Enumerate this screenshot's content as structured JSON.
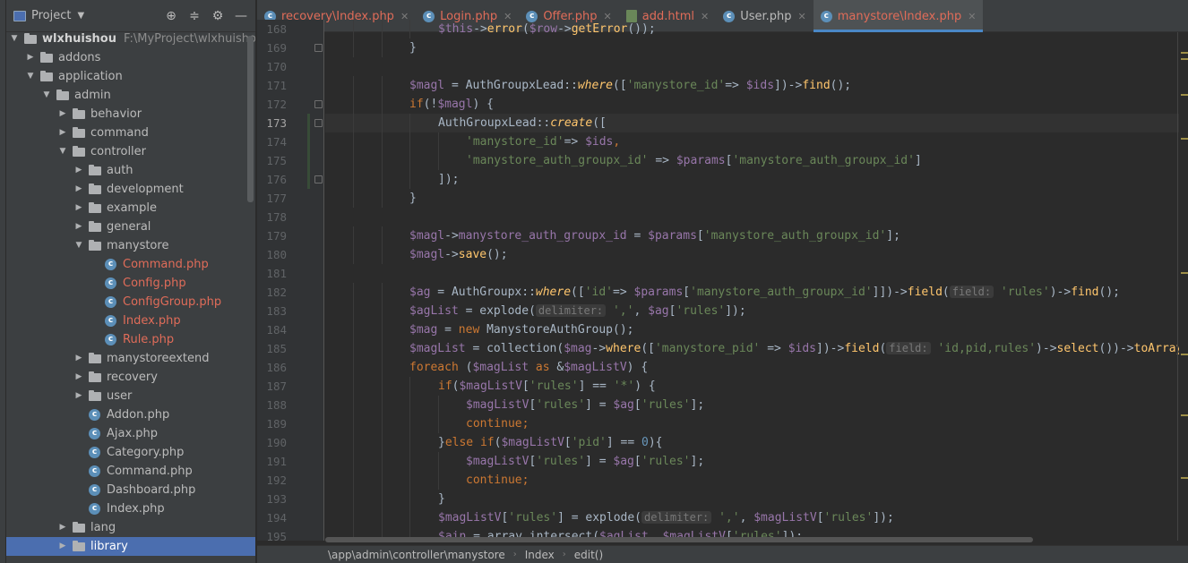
{
  "project_panel": {
    "title": "Project",
    "tools": [
      "crosshair-icon",
      "collapse-icon",
      "gear-icon",
      "minimize-icon"
    ],
    "tree": [
      {
        "level": 0,
        "type": "folder",
        "open": true,
        "label": "wlxhuishou",
        "path": "F:\\MyProject\\wlxhuishou",
        "bold": true
      },
      {
        "level": 1,
        "type": "folder",
        "open": false,
        "label": "addons"
      },
      {
        "level": 1,
        "type": "folder",
        "open": true,
        "label": "application"
      },
      {
        "level": 2,
        "type": "folder",
        "open": true,
        "label": "admin"
      },
      {
        "level": 3,
        "type": "folder",
        "open": false,
        "label": "behavior"
      },
      {
        "level": 3,
        "type": "folder",
        "open": false,
        "label": "command"
      },
      {
        "level": 3,
        "type": "folder",
        "open": true,
        "label": "controller"
      },
      {
        "level": 4,
        "type": "folder",
        "open": false,
        "label": "auth"
      },
      {
        "level": 4,
        "type": "folder",
        "open": false,
        "label": "development"
      },
      {
        "level": 4,
        "type": "folder",
        "open": false,
        "label": "example"
      },
      {
        "level": 4,
        "type": "folder",
        "open": false,
        "label": "general"
      },
      {
        "level": 4,
        "type": "folder",
        "open": true,
        "label": "manystore"
      },
      {
        "level": 5,
        "type": "php",
        "label": "Command.php",
        "modified": true
      },
      {
        "level": 5,
        "type": "php",
        "label": "Config.php",
        "modified": true
      },
      {
        "level": 5,
        "type": "php",
        "label": "ConfigGroup.php",
        "modified": true
      },
      {
        "level": 5,
        "type": "php",
        "label": "Index.php",
        "modified": true
      },
      {
        "level": 5,
        "type": "php",
        "label": "Rule.php",
        "modified": true
      },
      {
        "level": 4,
        "type": "folder",
        "open": false,
        "label": "manystoreextend"
      },
      {
        "level": 4,
        "type": "folder",
        "open": false,
        "label": "recovery"
      },
      {
        "level": 4,
        "type": "folder",
        "open": false,
        "label": "user"
      },
      {
        "level": 4,
        "type": "php",
        "label": "Addon.php"
      },
      {
        "level": 4,
        "type": "php",
        "label": "Ajax.php"
      },
      {
        "level": 4,
        "type": "php",
        "label": "Category.php"
      },
      {
        "level": 4,
        "type": "php",
        "label": "Command.php"
      },
      {
        "level": 4,
        "type": "php",
        "label": "Dashboard.php"
      },
      {
        "level": 4,
        "type": "php",
        "label": "Index.php"
      },
      {
        "level": 3,
        "type": "folder",
        "open": false,
        "label": "lang"
      },
      {
        "level": 3,
        "type": "folder",
        "open": false,
        "label": "library",
        "selected": true
      }
    ]
  },
  "tabs": [
    {
      "label": "recovery\\Index.php",
      "icon": "php-icon",
      "modified": true,
      "active": false
    },
    {
      "label": "Login.php",
      "icon": "php-icon",
      "modified": true,
      "active": false
    },
    {
      "label": "Offer.php",
      "icon": "php-icon",
      "modified": true,
      "active": false
    },
    {
      "label": "add.html",
      "icon": "html-icon",
      "modified": true,
      "active": false
    },
    {
      "label": "User.php",
      "icon": "php-icon",
      "modified": false,
      "active": false
    },
    {
      "label": "manystore\\Index.php",
      "icon": "php-icon",
      "modified": true,
      "active": true
    }
  ],
  "editor": {
    "current_line": 173,
    "lines": [
      {
        "n": 168,
        "indent": 16,
        "tokens": [
          [
            "var",
            "$this"
          ],
          [
            "",
            "->"
          ],
          [
            "fn",
            "error"
          ],
          [
            "",
            "("
          ],
          [
            "var",
            "$row"
          ],
          [
            "",
            "->"
          ],
          [
            "fn",
            "getError"
          ],
          [
            "",
            "());"
          ]
        ]
      },
      {
        "n": 169,
        "indent": 12,
        "tokens": [
          [
            "",
            "}"
          ]
        ]
      },
      {
        "n": 170,
        "indent": 0,
        "tokens": []
      },
      {
        "n": 171,
        "indent": 12,
        "tokens": [
          [
            "var",
            "$magl"
          ],
          [
            "",
            " = "
          ],
          [
            "cls",
            "AuthGroupxLead"
          ],
          [
            "",
            "::"
          ],
          [
            "static",
            "where"
          ],
          [
            "",
            "(["
          ],
          [
            "str",
            "'manystore_id'"
          ],
          [
            "",
            "=> "
          ],
          [
            "var",
            "$ids"
          ],
          [
            "",
            "])->"
          ],
          [
            "fn",
            "find"
          ],
          [
            "",
            "();"
          ]
        ]
      },
      {
        "n": 172,
        "indent": 12,
        "tokens": [
          [
            "kw",
            "if"
          ],
          [
            "",
            "(!"
          ],
          [
            "var",
            "$magl"
          ],
          [
            "",
            ") {"
          ]
        ]
      },
      {
        "n": 173,
        "indent": 16,
        "tokens": [
          [
            "cls",
            "AuthGroupxLead"
          ],
          [
            "",
            "::"
          ],
          [
            "static",
            "create"
          ],
          [
            "",
            "(["
          ]
        ]
      },
      {
        "n": 174,
        "indent": 20,
        "tokens": [
          [
            "str",
            "'manystore_id'"
          ],
          [
            "",
            "=> "
          ],
          [
            "var",
            "$ids"
          ],
          [
            "kw",
            ","
          ]
        ]
      },
      {
        "n": 175,
        "indent": 20,
        "tokens": [
          [
            "str",
            "'manystore_auth_groupx_id'"
          ],
          [
            "",
            " => "
          ],
          [
            "var",
            "$params"
          ],
          [
            "",
            "["
          ],
          [
            "str",
            "'manystore_auth_groupx_id'"
          ],
          [
            "",
            "]"
          ]
        ]
      },
      {
        "n": 176,
        "indent": 16,
        "tokens": [
          [
            "",
            "]);"
          ]
        ]
      },
      {
        "n": 177,
        "indent": 12,
        "tokens": [
          [
            "",
            "}"
          ]
        ]
      },
      {
        "n": 178,
        "indent": 0,
        "tokens": []
      },
      {
        "n": 179,
        "indent": 12,
        "tokens": [
          [
            "var",
            "$magl"
          ],
          [
            "",
            "->"
          ],
          [
            "var",
            "manystore_auth_groupx_id"
          ],
          [
            "",
            " = "
          ],
          [
            "var",
            "$params"
          ],
          [
            "",
            "["
          ],
          [
            "str",
            "'manystore_auth_groupx_id'"
          ],
          [
            "",
            "];"
          ]
        ]
      },
      {
        "n": 180,
        "indent": 12,
        "tokens": [
          [
            "var",
            "$magl"
          ],
          [
            "",
            "->"
          ],
          [
            "fn",
            "save"
          ],
          [
            "",
            "();"
          ]
        ]
      },
      {
        "n": 181,
        "indent": 0,
        "tokens": []
      },
      {
        "n": 182,
        "indent": 12,
        "tokens": [
          [
            "var",
            "$ag"
          ],
          [
            "",
            " = "
          ],
          [
            "cls",
            "AuthGroupx"
          ],
          [
            "",
            "::"
          ],
          [
            "static",
            "where"
          ],
          [
            "",
            "(["
          ],
          [
            "str",
            "'id'"
          ],
          [
            "",
            "=> "
          ],
          [
            "var",
            "$params"
          ],
          [
            "",
            "["
          ],
          [
            "str",
            "'manystore_auth_groupx_id'"
          ],
          [
            "",
            "]])->"
          ],
          [
            "fn",
            "field"
          ],
          [
            "",
            "("
          ],
          [
            "hint",
            "field:"
          ],
          [
            "str",
            " 'rules'"
          ],
          [
            "",
            ")->"
          ],
          [
            "fn",
            "find"
          ],
          [
            "",
            "();"
          ]
        ]
      },
      {
        "n": 183,
        "indent": 12,
        "tokens": [
          [
            "var",
            "$agList"
          ],
          [
            "",
            " = "
          ],
          [
            "",
            "explode("
          ],
          [
            "hint",
            "delimiter:"
          ],
          [
            "str",
            " ','"
          ],
          [
            "",
            ", "
          ],
          [
            "var",
            "$ag"
          ],
          [
            "",
            "["
          ],
          [
            "str",
            "'rules'"
          ],
          [
            "",
            "]);"
          ]
        ]
      },
      {
        "n": 184,
        "indent": 12,
        "tokens": [
          [
            "var",
            "$mag"
          ],
          [
            "",
            " = "
          ],
          [
            "kw",
            "new "
          ],
          [
            "cls",
            "ManystoreAuthGroup"
          ],
          [
            "",
            "();"
          ]
        ]
      },
      {
        "n": 185,
        "indent": 12,
        "tokens": [
          [
            "var",
            "$magList"
          ],
          [
            "",
            " = "
          ],
          [
            "",
            "collection("
          ],
          [
            "var",
            "$mag"
          ],
          [
            "",
            "->"
          ],
          [
            "fn",
            "where"
          ],
          [
            "",
            "(["
          ],
          [
            "str",
            "'manystore_pid'"
          ],
          [
            "",
            " => "
          ],
          [
            "var",
            "$ids"
          ],
          [
            "",
            "])->"
          ],
          [
            "fn",
            "field"
          ],
          [
            "",
            "("
          ],
          [
            "hint",
            "field:"
          ],
          [
            "str",
            " 'id,pid,rules'"
          ],
          [
            "",
            ")->"
          ],
          [
            "fn",
            "select"
          ],
          [
            "",
            "())->"
          ],
          [
            "fn",
            "toArray"
          ],
          [
            "",
            "());"
          ]
        ]
      },
      {
        "n": 186,
        "indent": 12,
        "tokens": [
          [
            "kw",
            "foreach "
          ],
          [
            "",
            "("
          ],
          [
            "var",
            "$magList"
          ],
          [
            "kw",
            " as "
          ],
          [
            "",
            "&"
          ],
          [
            "var",
            "$magListV"
          ],
          [
            "",
            ") {"
          ]
        ]
      },
      {
        "n": 187,
        "indent": 16,
        "tokens": [
          [
            "kw",
            "if"
          ],
          [
            "",
            "("
          ],
          [
            "var",
            "$magListV"
          ],
          [
            "",
            "["
          ],
          [
            "str",
            "'rules'"
          ],
          [
            "",
            "] == "
          ],
          [
            "str",
            "'*'"
          ],
          [
            "",
            ") {"
          ]
        ]
      },
      {
        "n": 188,
        "indent": 20,
        "tokens": [
          [
            "var",
            "$magListV"
          ],
          [
            "",
            "["
          ],
          [
            "str",
            "'rules'"
          ],
          [
            "",
            "] = "
          ],
          [
            "var",
            "$ag"
          ],
          [
            "",
            "["
          ],
          [
            "str",
            "'rules'"
          ],
          [
            "",
            "];"
          ]
        ]
      },
      {
        "n": 189,
        "indent": 20,
        "tokens": [
          [
            "kw",
            "continue;"
          ]
        ]
      },
      {
        "n": 190,
        "indent": 16,
        "tokens": [
          [
            "",
            "}"
          ],
          [
            "kw",
            "else if"
          ],
          [
            "",
            "("
          ],
          [
            "var",
            "$magListV"
          ],
          [
            "",
            "["
          ],
          [
            "str",
            "'pid'"
          ],
          [
            "",
            "] == "
          ],
          [
            "num",
            "0"
          ],
          [
            "",
            "){"
          ]
        ]
      },
      {
        "n": 191,
        "indent": 20,
        "tokens": [
          [
            "var",
            "$magListV"
          ],
          [
            "",
            "["
          ],
          [
            "str",
            "'rules'"
          ],
          [
            "",
            "] = "
          ],
          [
            "var",
            "$ag"
          ],
          [
            "",
            "["
          ],
          [
            "str",
            "'rules'"
          ],
          [
            "",
            "];"
          ]
        ]
      },
      {
        "n": 192,
        "indent": 20,
        "tokens": [
          [
            "kw",
            "continue;"
          ]
        ]
      },
      {
        "n": 193,
        "indent": 16,
        "tokens": [
          [
            "",
            "}"
          ]
        ]
      },
      {
        "n": 194,
        "indent": 16,
        "tokens": [
          [
            "var",
            "$magListV"
          ],
          [
            "",
            "["
          ],
          [
            "str",
            "'rules'"
          ],
          [
            "",
            "] = "
          ],
          [
            "",
            "explode("
          ],
          [
            "hint",
            "delimiter:"
          ],
          [
            "str",
            " ','"
          ],
          [
            "",
            ", "
          ],
          [
            "var",
            "$magListV"
          ],
          [
            "",
            "["
          ],
          [
            "str",
            "'rules'"
          ],
          [
            "",
            "]);"
          ]
        ]
      },
      {
        "n": 195,
        "indent": 16,
        "tokens": [
          [
            "var",
            "$ain"
          ],
          [
            "",
            " = "
          ],
          [
            "",
            "array_intersect("
          ],
          [
            "var",
            "$agList"
          ],
          [
            "",
            ", "
          ],
          [
            "var",
            "$magListV"
          ],
          [
            "",
            "["
          ],
          [
            "str",
            "'rules'"
          ],
          [
            "",
            "]);"
          ]
        ]
      }
    ]
  },
  "breadcrumb": [
    "\\app\\admin\\controller\\manystore",
    "Index",
    "edit()"
  ],
  "colors": {
    "background": "#2b2b2b",
    "panel": "#3c3f41",
    "selection": "#4b6eaf",
    "modified": "#e06c59",
    "keyword": "#cc7832",
    "string": "#6a8759",
    "variable": "#9876aa",
    "function": "#ffc66d"
  }
}
